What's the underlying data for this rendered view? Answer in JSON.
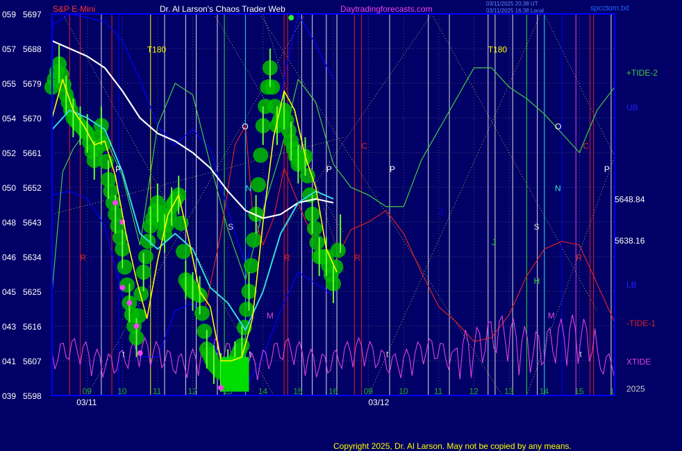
{
  "header": {
    "symbol": "S&P E-Mini",
    "title": "Dr. Al Larson's Chaos Trader Web",
    "site": "Daytradingforecasts.com",
    "stamp_utc": "03/11/2025 20:38 UT",
    "stamp_local": "03/11/2025 16:38 Local",
    "file": "spcctom.txt"
  },
  "footer": {
    "copyright": "Copyright 2025, Dr. Al Larson. May not be copied by any means."
  },
  "colors": {
    "background": "#000066",
    "grid": "#4a4a7a",
    "bands": "#0000ff",
    "white_avg": "#ffffff",
    "cyan_avg": "#33dddd",
    "yellow": "#ffff00",
    "green": "#00bb00",
    "magenta": "#ee44ee",
    "tide2": "#44cc44",
    "tide1": "#dd2222",
    "xtide": "#dd44dd",
    "label_red": "#ff3333"
  },
  "chart_data": {
    "type": "line",
    "title": "S&P E-Mini",
    "y_ticks": [
      {
        "left": "059",
        "right": "5697"
      },
      {
        "left": "057",
        "right": "5688"
      },
      {
        "left": "055",
        "right": "5679"
      },
      {
        "left": "054",
        "right": "5670"
      },
      {
        "left": "052",
        "right": "5661"
      },
      {
        "left": "050",
        "right": "5652"
      },
      {
        "left": "048",
        "right": "5643"
      },
      {
        "left": "046",
        "right": "5634"
      },
      {
        "left": "045",
        "right": "5625"
      },
      {
        "left": "043",
        "right": "5616"
      },
      {
        "left": "041",
        "right": "5607"
      },
      {
        "left": "039",
        "right": "5598"
      }
    ],
    "ylim": [
      5598,
      5697
    ],
    "x_ticks": [
      {
        "label": "09",
        "x": 9
      },
      {
        "label": "10",
        "x": 10
      },
      {
        "label": "11",
        "x": 11
      },
      {
        "label": "12",
        "x": 12
      },
      {
        "label": "13",
        "x": 13
      },
      {
        "label": "14",
        "x": 14
      },
      {
        "label": "15",
        "x": 15
      },
      {
        "label": "16",
        "x": 16
      },
      {
        "label": "09",
        "x": 17
      },
      {
        "label": "10",
        "x": 18
      },
      {
        "label": "11",
        "x": 19
      },
      {
        "label": "12",
        "x": 20
      },
      {
        "label": "13",
        "x": 21
      },
      {
        "label": "14",
        "x": 22
      },
      {
        "label": "15",
        "x": 23
      },
      {
        "label": "1",
        "x": 24
      }
    ],
    "xlim": [
      8.0,
      24.0
    ],
    "dates": [
      {
        "label": "03/11",
        "x": 8.3
      },
      {
        "label": "03/12",
        "x": 16.6
      }
    ],
    "price_labels": [
      "5648.84",
      "5638.16"
    ],
    "right_labels": [
      {
        "text": "+TIDE-2",
        "color": "#44cc44",
        "y": 5681
      },
      {
        "text": "UB",
        "color": "#2222ff",
        "y": 5672
      },
      {
        "text": "LB",
        "color": "#2222ff",
        "y": 5626
      },
      {
        "text": "-TIDE-1",
        "color": "#dd2222",
        "y": 5616
      },
      {
        "text": "XTIDE",
        "color": "#dd44dd",
        "y": 5606
      },
      {
        "text": "2025",
        "color": "#cccccc",
        "y": 5599
      }
    ],
    "markers": [
      {
        "text": "T180",
        "x": 10.7,
        "y": 5687,
        "color": "#ffff00"
      },
      {
        "text": "T180",
        "x": 20.4,
        "y": 5687,
        "color": "#ffff00"
      },
      {
        "text": "O",
        "x": 13.4,
        "y": 5667,
        "color": "#ffffff"
      },
      {
        "text": "O",
        "x": 22.3,
        "y": 5667,
        "color": "#ffffff"
      },
      {
        "text": "C",
        "x": 16.8,
        "y": 5662,
        "color": "#dd2222"
      },
      {
        "text": "C",
        "x": 23.1,
        "y": 5662,
        "color": "#dd2222"
      },
      {
        "text": "P",
        "x": 9.8,
        "y": 5656,
        "color": "#ffffff"
      },
      {
        "text": "P",
        "x": 15.8,
        "y": 5656,
        "color": "#ffffff"
      },
      {
        "text": "P",
        "x": 17.6,
        "y": 5656,
        "color": "#ffffff"
      },
      {
        "text": "P",
        "x": 23.7,
        "y": 5656,
        "color": "#ffffff"
      },
      {
        "text": "N",
        "x": 13.5,
        "y": 5651,
        "color": "#33dddd"
      },
      {
        "text": "N",
        "x": 22.3,
        "y": 5651,
        "color": "#33dddd"
      },
      {
        "text": "S",
        "x": 13.0,
        "y": 5641,
        "color": "#dddddd"
      },
      {
        "text": "S",
        "x": 21.7,
        "y": 5641,
        "color": "#dddddd"
      },
      {
        "text": "J",
        "x": 19.0,
        "y": 5645,
        "color": "#0000ff"
      },
      {
        "text": "J",
        "x": 20.5,
        "y": 5637,
        "color": "#33dd33"
      },
      {
        "text": "R",
        "x": 8.8,
        "y": 5633,
        "color": "#dd2222"
      },
      {
        "text": "R",
        "x": 14.6,
        "y": 5633,
        "color": "#dd2222"
      },
      {
        "text": "R",
        "x": 16.6,
        "y": 5633,
        "color": "#dd2222"
      },
      {
        "text": "R",
        "x": 22.9,
        "y": 5633,
        "color": "#dd2222"
      },
      {
        "text": "H",
        "x": 21.7,
        "y": 5627,
        "color": "#33dd33"
      },
      {
        "text": "M",
        "x": 14.1,
        "y": 5618,
        "color": "#dd44dd"
      },
      {
        "text": "M",
        "x": 22.1,
        "y": 5618,
        "color": "#dd44dd"
      },
      {
        "text": "t",
        "x": 10.0,
        "y": 5608,
        "color": "#dddddd"
      },
      {
        "text": "t",
        "x": 13.6,
        "y": 5608,
        "color": "#dddddd"
      },
      {
        "text": "t",
        "x": 17.5,
        "y": 5608,
        "color": "#dddddd"
      },
      {
        "text": "t",
        "x": 23.0,
        "y": 5608,
        "color": "#dddddd"
      }
    ],
    "series": [
      {
        "kind": "price",
        "x": [
          8.0,
          8.2,
          8.4,
          8.6,
          8.8,
          9.0,
          9.2,
          9.4,
          9.6,
          9.8,
          10.0,
          10.2,
          10.4,
          10.6,
          10.8,
          11.0,
          11.2,
          11.4,
          11.6,
          11.8,
          12.0,
          12.2,
          12.4,
          12.6,
          12.8,
          13.0,
          13.2,
          13.4,
          13.6,
          13.8,
          14.0,
          14.2,
          14.4,
          14.6,
          14.8,
          15.0,
          15.2,
          15.4,
          15.6,
          15.8,
          16.0,
          16.2
        ],
        "y": [
          5678,
          5684,
          5676,
          5670,
          5668,
          5666,
          5659,
          5668,
          5654,
          5645,
          5636,
          5622,
          5613,
          5630,
          5642,
          5648,
          5640,
          5647,
          5650,
          5628,
          5625,
          5624,
          5610,
          5606,
          5604,
          5605,
          5607,
          5611,
          5625,
          5645,
          5668,
          5683,
          5668,
          5672,
          5664,
          5658,
          5660,
          5645,
          5634,
          5634,
          5627,
          5640
        ]
      },
      {
        "kind": "yellow",
        "x": [
          8.0,
          8.3,
          8.6,
          8.9,
          9.2,
          9.5,
          9.8,
          10.1,
          10.4,
          10.7,
          11.0,
          11.3,
          11.6,
          11.9,
          12.2,
          12.5,
          12.8,
          13.1,
          13.4,
          13.7,
          14.0,
          14.3,
          14.6,
          14.9,
          15.2,
          15.5,
          15.8,
          16.1
        ],
        "y": [
          5670,
          5680,
          5672,
          5668,
          5663,
          5664,
          5655,
          5640,
          5628,
          5618,
          5633,
          5645,
          5650,
          5638,
          5625,
          5621,
          5607,
          5607,
          5608,
          5618,
          5643,
          5665,
          5677,
          5672,
          5660,
          5652,
          5636,
          5630
        ]
      },
      {
        "kind": "cyan",
        "x": [
          8.0,
          8.5,
          9.0,
          9.5,
          10.0,
          10.5,
          11.0,
          11.5,
          12.0,
          12.5,
          13.0,
          13.5,
          14.0,
          14.5,
          15.0,
          15.5,
          16.0
        ],
        "y": [
          5667,
          5672,
          5670,
          5667,
          5656,
          5640,
          5636,
          5640,
          5636,
          5626,
          5622,
          5615,
          5625,
          5640,
          5648,
          5651,
          5649
        ]
      },
      {
        "kind": "white",
        "x": [
          8.0,
          8.5,
          9.0,
          9.5,
          10.0,
          10.5,
          11.0,
          11.5,
          12.0,
          12.5,
          13.0,
          13.5,
          14.0,
          14.5,
          15.0,
          15.5,
          16.0
        ],
        "y": [
          5690,
          5688,
          5686,
          5683,
          5677,
          5670,
          5666,
          5664,
          5661,
          5657,
          5651,
          5646,
          5644,
          5645,
          5648,
          5649,
          5648
        ]
      },
      {
        "kind": "tide2",
        "x": [
          8.0,
          8.3,
          8.6,
          9.0,
          9.5,
          10.0,
          10.5,
          11.0,
          11.5,
          12.0,
          12.5,
          13.0,
          13.5,
          14.0,
          14.5,
          15.0,
          15.5,
          16.0,
          16.5,
          17.0,
          17.5,
          18.0,
          18.5,
          19.0,
          19.5,
          20.0,
          20.5,
          21.0,
          21.5,
          22.0,
          22.5,
          23.0,
          23.5,
          24.0
        ],
        "y": [
          5625,
          5656,
          5662,
          5667,
          5665,
          5655,
          5637,
          5668,
          5679,
          5676,
          5658,
          5641,
          5628,
          5646,
          5661,
          5680,
          5674,
          5658,
          5652,
          5650,
          5647,
          5647,
          5659,
          5667,
          5675,
          5683,
          5683,
          5678,
          5675,
          5671,
          5666,
          5661,
          5672,
          5678
        ]
      },
      {
        "kind": "tide1",
        "x": [
          12.3,
          12.8,
          13.2,
          13.5,
          13.7,
          14.0,
          14.3,
          14.6,
          15.0,
          15.5,
          16.0,
          16.5,
          17.0,
          17.5,
          18.0,
          18.5,
          19.0,
          19.5,
          20.0,
          20.5,
          21.0,
          21.5,
          22.0,
          22.5,
          23.0,
          23.5,
          24.0
        ],
        "y": [
          5618,
          5640,
          5663,
          5668,
          5646,
          5637,
          5644,
          5657,
          5648,
          5637,
          5632,
          5641,
          5643,
          5646,
          5640,
          5630,
          5621,
          5617,
          5612,
          5613,
          5619,
          5629,
          5636,
          5638,
          5637,
          5627,
          5617
        ]
      },
      {
        "kind": "bandUp",
        "x": [
          8.0,
          8.5,
          9.0,
          9.5,
          10.0,
          10.5,
          11.0,
          11.5,
          12.0,
          12.5,
          13.0,
          13.5,
          14.0,
          14.5,
          15.0,
          15.5,
          16.0
        ],
        "y": [
          5694,
          5697,
          5696,
          5695,
          5690,
          5680,
          5668,
          5663,
          5667,
          5662,
          5646,
          5632,
          5646,
          5676,
          5697,
          5689,
          5680
        ]
      },
      {
        "kind": "bandDn",
        "x": [
          8.0,
          8.5,
          9.0,
          9.5,
          10.0,
          10.5,
          11.0,
          11.5,
          12.0,
          12.5,
          13.0,
          13.5,
          14.0,
          14.5,
          15.0,
          15.5,
          16.0
        ],
        "y": [
          5650,
          5651,
          5649,
          5642,
          5624,
          5608,
          5608,
          5620,
          5622,
          5613,
          5604,
          5600,
          5608,
          5620,
          5630,
          5627,
          5624
        ]
      }
    ]
  }
}
